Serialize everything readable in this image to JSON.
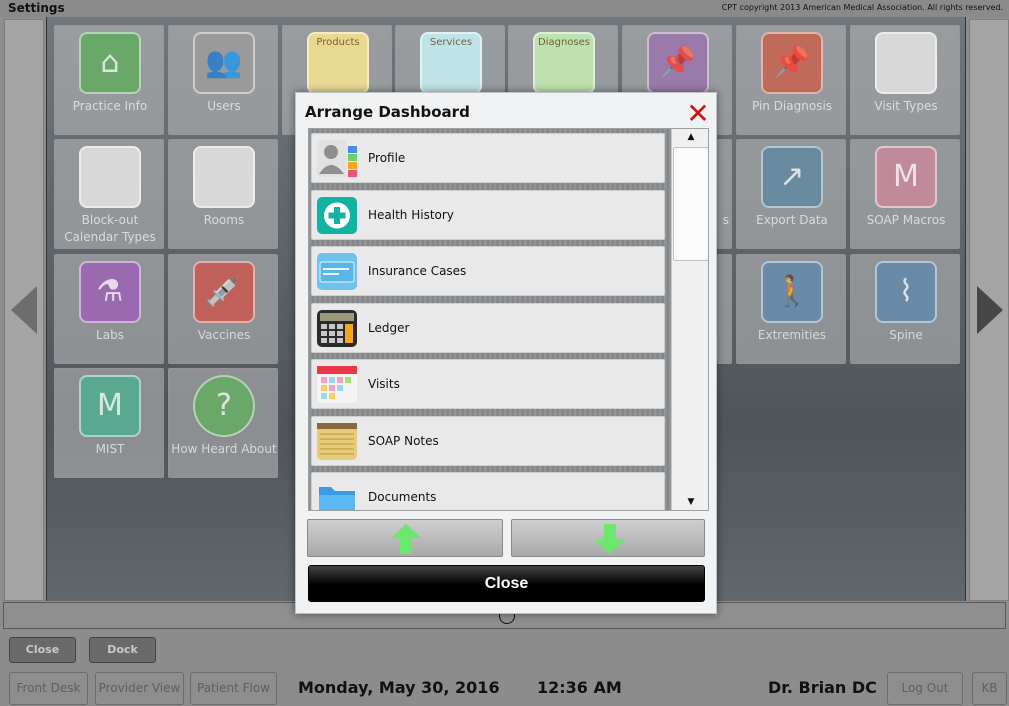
{
  "app": {
    "title": "Settings",
    "copyright": "CPT copyright 2013 American Medical Association. All rights reserved."
  },
  "background_tiles": [
    {
      "label": "Practice Info",
      "icon": "house-icon",
      "color": "#6aa86a"
    },
    {
      "label": "Users",
      "icon": "users-icon",
      "color": "#9a9a9a"
    },
    {
      "label": "",
      "tag": "Products",
      "icon": "checklist-icon",
      "color": "#e8d890"
    },
    {
      "label": "",
      "tag": "Services",
      "icon": "checklist-icon",
      "color": "#bfe3e6"
    },
    {
      "label": "",
      "tag": "Diagnoses",
      "icon": "checklist-icon",
      "color": "#bfe0b0"
    },
    {
      "label": "",
      "icon": "pin-icon",
      "color": "#9a7aa8"
    },
    {
      "label": "Pin Diagnosis",
      "icon": "pin-icon",
      "color": "#c06a5a"
    },
    {
      "label": "Visit Types",
      "icon": "list-icon",
      "color": "#d8d8d8"
    },
    {
      "label": "Block-out Calendar Types",
      "icon": "list-icon",
      "color": "#d8d8d8"
    },
    {
      "label": "Rooms",
      "icon": "door-icon",
      "color": "#d8d8d8"
    },
    {
      "label": "",
      "icon": "",
      "color": ""
    },
    {
      "label": "",
      "icon": "",
      "color": ""
    },
    {
      "label": "",
      "icon": "",
      "color": ""
    },
    {
      "label": "s",
      "icon": "",
      "color": ""
    },
    {
      "label": "Export Data",
      "icon": "export-icon",
      "color": "#6a8aa0"
    },
    {
      "label": "SOAP Macros",
      "icon": "macro-icon",
      "color": "#c08a9a"
    },
    {
      "label": "Labs",
      "icon": "flask-icon",
      "color": "#9a6ab0"
    },
    {
      "label": "Vaccines",
      "icon": "syringe-icon",
      "color": "#c0605a"
    },
    {
      "label": "Extremities",
      "icon": "body-icon",
      "color": "#6a8aa8"
    },
    {
      "label": "Spine",
      "icon": "spine-icon",
      "color": "#6a8aa8"
    },
    {
      "label": "MIST",
      "icon": "mist-icon",
      "color": "#5aa890"
    },
    {
      "label": "How Heard About",
      "icon": "question-bubble-icon",
      "color": "#6aa86a"
    }
  ],
  "modal": {
    "title": "Arrange Dashboard",
    "close_x": "✕",
    "items": [
      {
        "label": "Profile",
        "icon": "profile-icon"
      },
      {
        "label": "Health History",
        "icon": "health-plus-icon"
      },
      {
        "label": "Insurance Cases",
        "icon": "insurance-card-icon"
      },
      {
        "label": "Ledger",
        "icon": "calculator-icon"
      },
      {
        "label": "Visits",
        "icon": "calendar-icon"
      },
      {
        "label": "SOAP Notes",
        "icon": "notepad-icon"
      },
      {
        "label": "Documents",
        "icon": "folder-icon"
      }
    ],
    "scroll_up": "▲",
    "scroll_down": "▼",
    "close_label": "Close"
  },
  "dock": {
    "close_label": "Close",
    "dock_label": "Dock"
  },
  "footer": {
    "front_desk": "Front Desk",
    "provider_view": "Provider View",
    "patient_flow": "Patient Flow",
    "date": "Monday, May 30, 2016",
    "time": "12:36 AM",
    "doctor": "Dr. Brian DC",
    "log_out": "Log Out",
    "kb": "KB"
  }
}
